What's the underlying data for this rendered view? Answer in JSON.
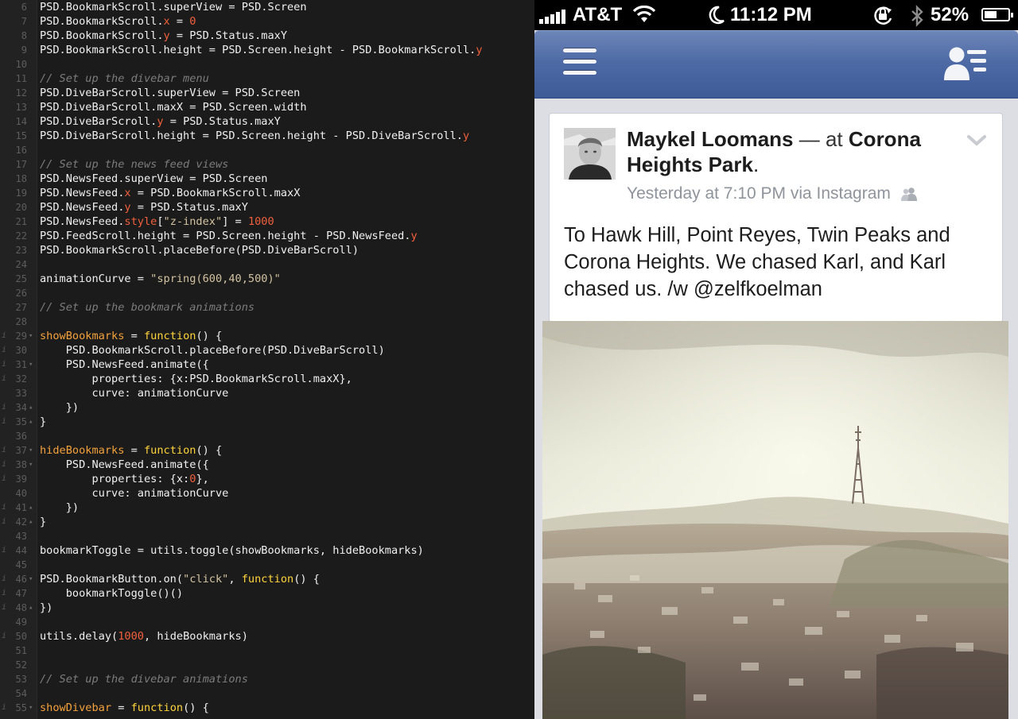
{
  "editor": {
    "lines": [
      {
        "n": "6",
        "fold": "",
        "info": "",
        "tokens": [
          [
            "p",
            "PSD.BookmarkScroll.superView = PSD.Screen"
          ]
        ]
      },
      {
        "n": "7",
        "fold": "",
        "info": "",
        "tokens": [
          [
            "p",
            "PSD.BookmarkScroll."
          ],
          [
            "n",
            "x"
          ],
          [
            "p",
            " = "
          ],
          [
            "n",
            "0"
          ]
        ]
      },
      {
        "n": "8",
        "fold": "",
        "info": "",
        "tokens": [
          [
            "p",
            "PSD.BookmarkScroll."
          ],
          [
            "n",
            "y"
          ],
          [
            "p",
            " = PSD.Status.maxY"
          ]
        ]
      },
      {
        "n": "9",
        "fold": "",
        "info": "",
        "tokens": [
          [
            "p",
            "PSD.BookmarkScroll.height = PSD.Screen.height - PSD.BookmarkScroll."
          ],
          [
            "n",
            "y"
          ]
        ]
      },
      {
        "n": "10",
        "fold": "",
        "info": "",
        "tokens": []
      },
      {
        "n": "11",
        "fold": "",
        "info": "",
        "tokens": [
          [
            "c",
            "// Set up the divebar menu"
          ]
        ]
      },
      {
        "n": "12",
        "fold": "",
        "info": "",
        "tokens": [
          [
            "p",
            "PSD.DiveBarScroll.superView = PSD.Screen"
          ]
        ]
      },
      {
        "n": "13",
        "fold": "",
        "info": "",
        "tokens": [
          [
            "p",
            "PSD.DiveBarScroll.maxX = PSD.Screen.width"
          ]
        ]
      },
      {
        "n": "14",
        "fold": "",
        "info": "",
        "tokens": [
          [
            "p",
            "PSD.DiveBarScroll."
          ],
          [
            "n",
            "y"
          ],
          [
            "p",
            " = PSD.Status.maxY"
          ]
        ]
      },
      {
        "n": "15",
        "fold": "",
        "info": "",
        "tokens": [
          [
            "p",
            "PSD.DiveBarScroll.height = PSD.Screen.height - PSD.DiveBarScroll."
          ],
          [
            "n",
            "y"
          ]
        ]
      },
      {
        "n": "16",
        "fold": "",
        "info": "",
        "tokens": []
      },
      {
        "n": "17",
        "fold": "",
        "info": "",
        "tokens": [
          [
            "c",
            "// Set up the news feed views"
          ]
        ]
      },
      {
        "n": "18",
        "fold": "",
        "info": "",
        "tokens": [
          [
            "p",
            "PSD.NewsFeed.superView = PSD.Screen"
          ]
        ]
      },
      {
        "n": "19",
        "fold": "",
        "info": "",
        "tokens": [
          [
            "p",
            "PSD.NewsFeed."
          ],
          [
            "n",
            "x"
          ],
          [
            "p",
            " = PSD.BookmarkScroll.maxX"
          ]
        ]
      },
      {
        "n": "20",
        "fold": "",
        "info": "",
        "tokens": [
          [
            "p",
            "PSD.NewsFeed."
          ],
          [
            "n",
            "y"
          ],
          [
            "p",
            " = PSD.Status.maxY"
          ]
        ]
      },
      {
        "n": "21",
        "fold": "",
        "info": "",
        "tokens": [
          [
            "p",
            "PSD.NewsFeed."
          ],
          [
            "n",
            "style"
          ],
          [
            "p",
            "["
          ],
          [
            "s",
            "\"z-index\""
          ],
          [
            "p",
            "] = "
          ],
          [
            "n",
            "1000"
          ]
        ]
      },
      {
        "n": "22",
        "fold": "",
        "info": "",
        "tokens": [
          [
            "p",
            "PSD.FeedScroll.height = PSD.Screen.height - PSD.NewsFeed."
          ],
          [
            "n",
            "y"
          ]
        ]
      },
      {
        "n": "23",
        "fold": "",
        "info": "",
        "tokens": [
          [
            "p",
            "PSD.BookmarkScroll.placeBefore(PSD.DiveBarScroll)"
          ]
        ]
      },
      {
        "n": "24",
        "fold": "",
        "info": "",
        "tokens": []
      },
      {
        "n": "25",
        "fold": "",
        "info": "",
        "tokens": [
          [
            "p",
            "animationCurve = "
          ],
          [
            "s",
            "\"spring(600,40,500)\""
          ]
        ]
      },
      {
        "n": "26",
        "fold": "",
        "info": "",
        "tokens": []
      },
      {
        "n": "27",
        "fold": "",
        "info": "",
        "tokens": [
          [
            "c",
            "// Set up the bookmark animations"
          ]
        ]
      },
      {
        "n": "28",
        "fold": "",
        "info": "",
        "tokens": []
      },
      {
        "n": "29",
        "fold": "▾",
        "info": "i",
        "tokens": [
          [
            "f",
            "showBookmarks"
          ],
          [
            "p",
            " = "
          ],
          [
            "k",
            "function"
          ],
          [
            "p",
            "() {"
          ]
        ]
      },
      {
        "n": "30",
        "fold": "",
        "info": "i",
        "tokens": [
          [
            "p",
            "    PSD.BookmarkScroll.placeBefore(PSD.DiveBarScroll)"
          ]
        ]
      },
      {
        "n": "31",
        "fold": "▾",
        "info": "i",
        "tokens": [
          [
            "p",
            "    PSD.NewsFeed.animate({"
          ]
        ]
      },
      {
        "n": "32",
        "fold": "",
        "info": "i",
        "tokens": [
          [
            "p",
            "        properties: {x:PSD.BookmarkScroll.maxX},"
          ]
        ]
      },
      {
        "n": "33",
        "fold": "",
        "info": "",
        "tokens": [
          [
            "p",
            "        curve: animationCurve"
          ]
        ]
      },
      {
        "n": "34",
        "fold": "▴",
        "info": "i",
        "tokens": [
          [
            "p",
            "    })"
          ]
        ]
      },
      {
        "n": "35",
        "fold": "▴",
        "info": "i",
        "tokens": [
          [
            "p",
            "}"
          ]
        ]
      },
      {
        "n": "36",
        "fold": "",
        "info": "",
        "tokens": []
      },
      {
        "n": "37",
        "fold": "▾",
        "info": "i",
        "tokens": [
          [
            "f",
            "hideBookmarks"
          ],
          [
            "p",
            " = "
          ],
          [
            "k",
            "function"
          ],
          [
            "p",
            "() {"
          ]
        ]
      },
      {
        "n": "38",
        "fold": "▾",
        "info": "i",
        "tokens": [
          [
            "p",
            "    PSD.NewsFeed.animate({"
          ]
        ]
      },
      {
        "n": "39",
        "fold": "",
        "info": "i",
        "tokens": [
          [
            "p",
            "        properties: {x:"
          ],
          [
            "n",
            "0"
          ],
          [
            "p",
            "},"
          ]
        ]
      },
      {
        "n": "40",
        "fold": "",
        "info": "",
        "tokens": [
          [
            "p",
            "        curve: animationCurve"
          ]
        ]
      },
      {
        "n": "41",
        "fold": "▴",
        "info": "i",
        "tokens": [
          [
            "p",
            "    })"
          ]
        ]
      },
      {
        "n": "42",
        "fold": "▴",
        "info": "i",
        "tokens": [
          [
            "p",
            "}"
          ]
        ]
      },
      {
        "n": "43",
        "fold": "",
        "info": "",
        "tokens": []
      },
      {
        "n": "44",
        "fold": "",
        "info": "i",
        "tokens": [
          [
            "p",
            "bookmarkToggle = utils.toggle(showBookmarks, hideBookmarks)"
          ]
        ]
      },
      {
        "n": "45",
        "fold": "",
        "info": "",
        "tokens": []
      },
      {
        "n": "46",
        "fold": "▾",
        "info": "i",
        "tokens": [
          [
            "p",
            "PSD.BookmarkButton.on("
          ],
          [
            "s",
            "\"click\""
          ],
          [
            "p",
            ", "
          ],
          [
            "k",
            "function"
          ],
          [
            "p",
            "() {"
          ]
        ]
      },
      {
        "n": "47",
        "fold": "",
        "info": "i",
        "tokens": [
          [
            "p",
            "    bookmarkToggle()()"
          ]
        ]
      },
      {
        "n": "48",
        "fold": "▴",
        "info": "i",
        "tokens": [
          [
            "p",
            "})"
          ]
        ]
      },
      {
        "n": "49",
        "fold": "",
        "info": "",
        "tokens": []
      },
      {
        "n": "50",
        "fold": "",
        "info": "i",
        "tokens": [
          [
            "p",
            "utils.delay("
          ],
          [
            "n",
            "1000"
          ],
          [
            "p",
            ", hideBookmarks)"
          ]
        ]
      },
      {
        "n": "51",
        "fold": "",
        "info": "",
        "tokens": []
      },
      {
        "n": "52",
        "fold": "",
        "info": "",
        "tokens": []
      },
      {
        "n": "53",
        "fold": "",
        "info": "",
        "tokens": [
          [
            "c",
            "// Set up the divebar animations"
          ]
        ]
      },
      {
        "n": "54",
        "fold": "",
        "info": "",
        "tokens": []
      },
      {
        "n": "55",
        "fold": "▾",
        "info": "i",
        "tokens": [
          [
            "f",
            "showDivebar"
          ],
          [
            "p",
            " = "
          ],
          [
            "k",
            "function"
          ],
          [
            "p",
            "() {"
          ]
        ]
      }
    ]
  },
  "status_bar": {
    "carrier": "AT&T",
    "time": "11:12 PM",
    "battery": "52%",
    "battery_level": 0.52
  },
  "navbar": {
    "left_icon": "menu-icon",
    "right_icon": "friend-requests-icon"
  },
  "post": {
    "author": "Maykel Loomans",
    "separator": "— at",
    "place": "Corona Heights Park",
    "period": ".",
    "timestamp": "Yesterday at 7:10 PM via Instagram",
    "audience_icon": "friends-icon",
    "body": "To Hawk Hill, Point Reyes, Twin Peaks and Corona Heights. We chased Karl, and Karl chased us. /w @zelfkoelman"
  },
  "colors": {
    "editor_bg": "#1b1b1b",
    "navbar": "#4f6ba6",
    "feed_bg": "#dcdee3",
    "keyword": "#ffd43b",
    "function_name": "#f5a23c",
    "number": "#f0603c",
    "comment": "#7c7c7c"
  }
}
